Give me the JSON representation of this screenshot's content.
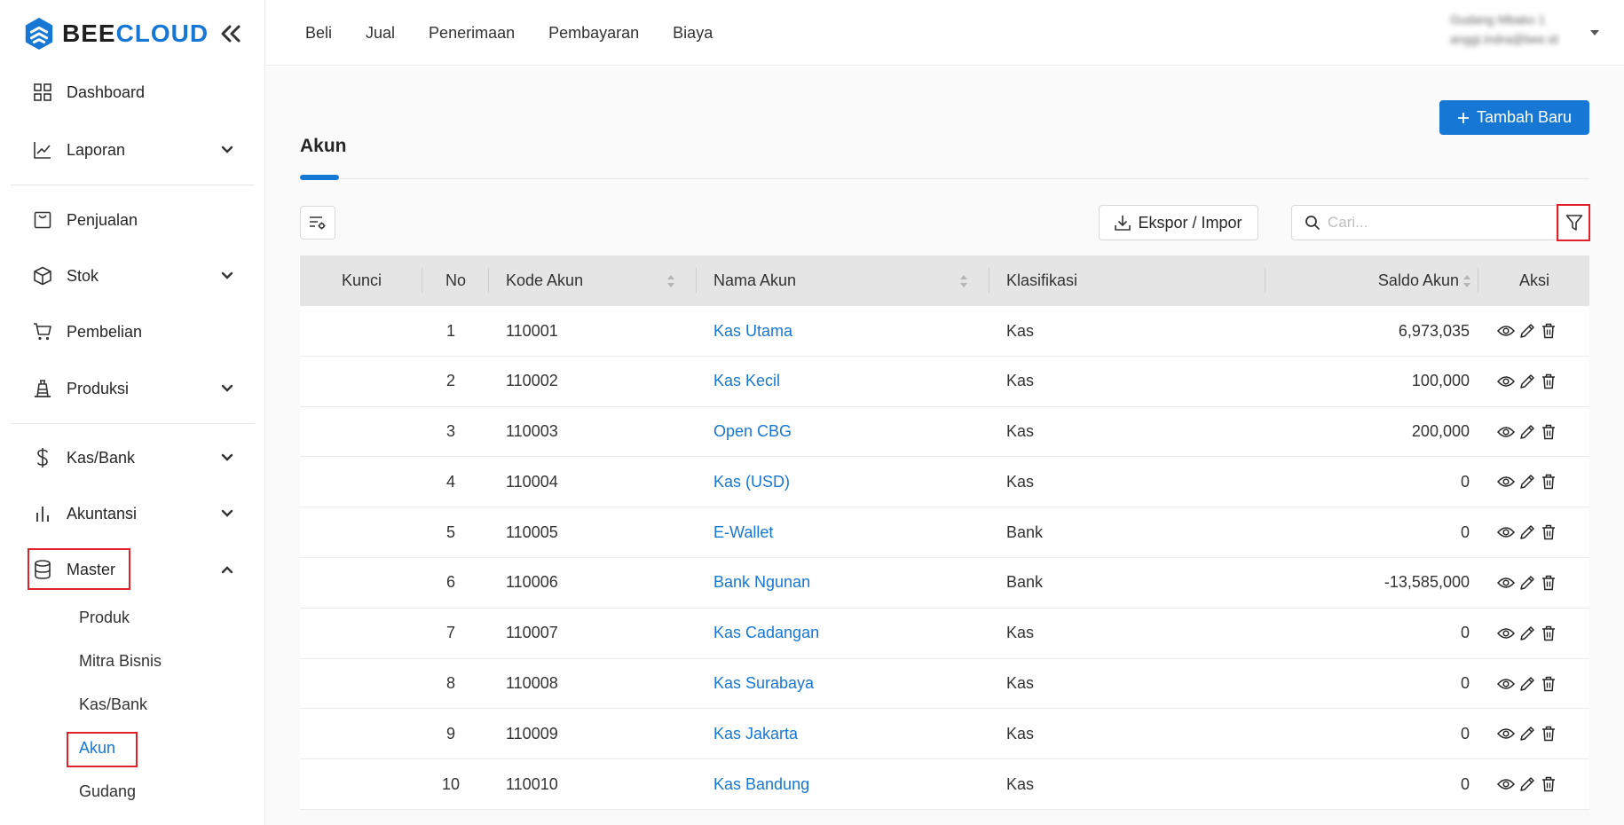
{
  "app": {
    "logo_bee": "BEE",
    "logo_cloud": "CLOUD"
  },
  "sidebar": {
    "items": [
      {
        "label": "Dashboard",
        "icon": "grid-icon"
      },
      {
        "label": "Laporan",
        "icon": "line-chart-icon"
      },
      {
        "label": "Penjualan",
        "icon": "receipt-icon"
      },
      {
        "label": "Stok",
        "icon": "box-icon"
      },
      {
        "label": "Pembelian",
        "icon": "cart-icon"
      },
      {
        "label": "Produksi",
        "icon": "factory-icon"
      },
      {
        "label": "Kas/Bank",
        "icon": "dollar-icon"
      },
      {
        "label": "Akuntansi",
        "icon": "bar-chart-icon"
      },
      {
        "label": "Master",
        "icon": "database-icon"
      }
    ],
    "master_sub": [
      "Produk",
      "Mitra Bisnis",
      "Kas/Bank",
      "Akun",
      "Gudang"
    ]
  },
  "header": {
    "nav": [
      "Beli",
      "Jual",
      "Penerimaan",
      "Pembayaran",
      "Biaya"
    ],
    "user_name": "Gudang Mbako 1",
    "user_email": "anggi.indra@bee.id"
  },
  "page": {
    "title": "Akun",
    "add_button": "Tambah Baru",
    "export_button": "Ekspor / Impor",
    "search_placeholder": "Cari..."
  },
  "table": {
    "columns": [
      "Kunci",
      "No",
      "Kode Akun",
      "Nama Akun",
      "Klasifikasi",
      "Saldo Akun",
      "Aksi"
    ],
    "rows": [
      {
        "no": "1",
        "kode": "110001",
        "nama": "Kas Utama",
        "klasifikasi": "Kas",
        "saldo": "6,973,035"
      },
      {
        "no": "2",
        "kode": "110002",
        "nama": "Kas Kecil",
        "klasifikasi": "Kas",
        "saldo": "100,000"
      },
      {
        "no": "3",
        "kode": "110003",
        "nama": "Open CBG",
        "klasifikasi": "Kas",
        "saldo": "200,000"
      },
      {
        "no": "4",
        "kode": "110004",
        "nama": "Kas (USD)",
        "klasifikasi": "Kas",
        "saldo": "0"
      },
      {
        "no": "5",
        "kode": "110005",
        "nama": "E-Wallet",
        "klasifikasi": "Bank",
        "saldo": "0"
      },
      {
        "no": "6",
        "kode": "110006",
        "nama": "Bank Ngunan",
        "klasifikasi": "Bank",
        "saldo": "-13,585,000"
      },
      {
        "no": "7",
        "kode": "110007",
        "nama": "Kas Cadangan",
        "klasifikasi": "Kas",
        "saldo": "0"
      },
      {
        "no": "8",
        "kode": "110008",
        "nama": "Kas Surabaya",
        "klasifikasi": "Kas",
        "saldo": "0"
      },
      {
        "no": "9",
        "kode": "110009",
        "nama": "Kas Jakarta",
        "klasifikasi": "Kas",
        "saldo": "0"
      },
      {
        "no": "10",
        "kode": "110010",
        "nama": "Kas Bandung",
        "klasifikasi": "Kas",
        "saldo": "0"
      }
    ]
  },
  "colors": {
    "accent": "#1677d4",
    "highlight": "#e0232b"
  }
}
